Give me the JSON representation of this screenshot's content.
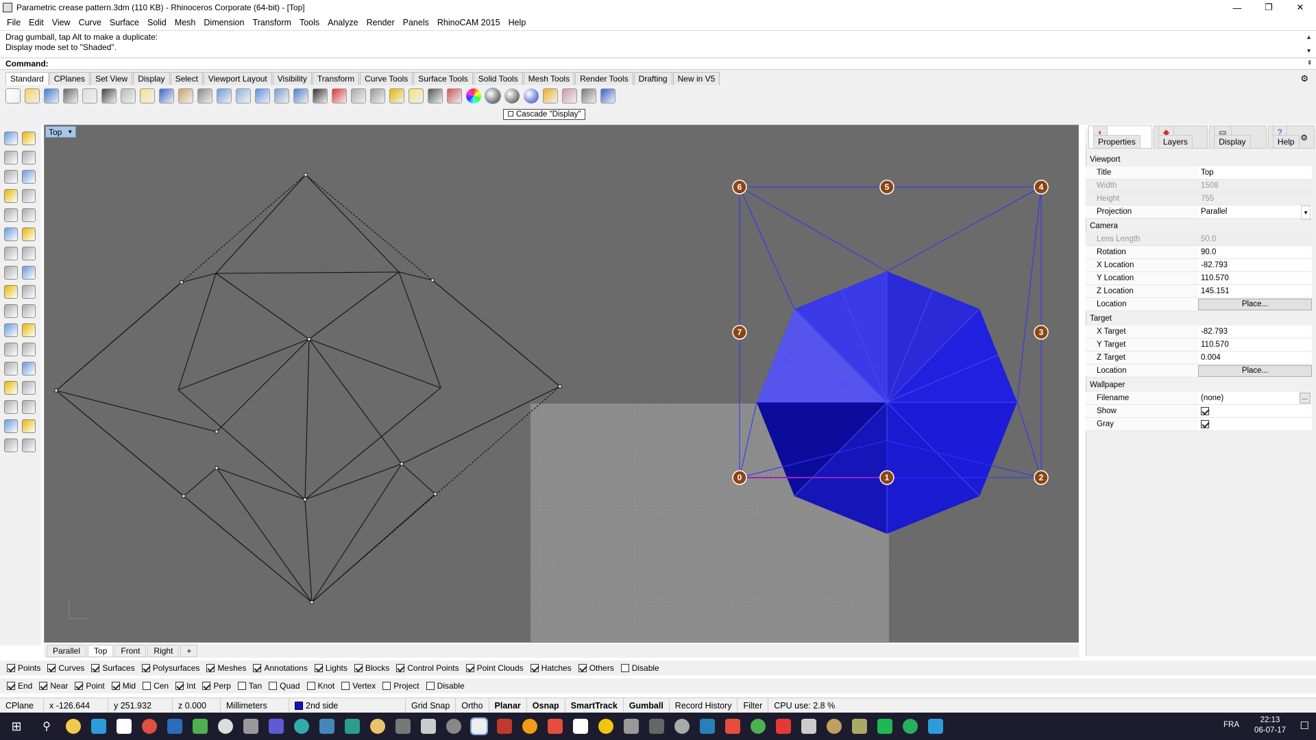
{
  "window": {
    "title": "Parametric crease pattern.3dm (110 KB) - Rhinoceros Corporate (64-bit) - [Top]",
    "minimize": "—",
    "maximize": "❐",
    "close": "✕"
  },
  "menu": [
    "File",
    "Edit",
    "View",
    "Curve",
    "Surface",
    "Solid",
    "Mesh",
    "Dimension",
    "Transform",
    "Tools",
    "Analyze",
    "Render",
    "Panels",
    "RhinoCAM 2015",
    "Help"
  ],
  "command_history": {
    "line1": "Drag gumball, tap Alt to make a duplicate:",
    "line2": "Display mode set to \"Shaded\"."
  },
  "command_prompt": "Command:",
  "toolbar_tabs": [
    "Standard",
    "CPlanes",
    "Set View",
    "Display",
    "Select",
    "Viewport Layout",
    "Visibility",
    "Transform",
    "Curve Tools",
    "Surface Tools",
    "Solid Tools",
    "Mesh Tools",
    "Render Tools",
    "Drafting",
    "New in V5"
  ],
  "toolbar_icons": [
    "new-file-icon",
    "open-file-icon",
    "save-icon",
    "print-icon",
    "import-icon",
    "cut-icon",
    "copy-icon",
    "paste-icon",
    "undo-icon",
    "pan-icon",
    "move-view-icon",
    "zoom-in-icon",
    "zoom-window-icon",
    "zoom-extents-icon",
    "zoom-selected-icon",
    "rotate-view-icon",
    "four-viewports-icon",
    "car-icon",
    "properties-icon",
    "circle-icon",
    "snap-icon",
    "light-icon",
    "lock-icon",
    "layer-icon",
    "color-wheel-icon",
    "shaded-sphere-icon",
    "rendered-sphere-icon",
    "blue-sphere-icon",
    "select-icon",
    "options-gear-icon",
    "snap-grid-icon",
    "help-icon"
  ],
  "tooltip": "Cascade \"Display\"",
  "viewport": {
    "name": "Top",
    "tabs": [
      "Parallel",
      "Top",
      "Front",
      "Right",
      "+"
    ],
    "active_tab": "Top",
    "point_labels": [
      "6",
      "5",
      "4",
      "7",
      "3",
      "0",
      "1",
      "2"
    ]
  },
  "panel": {
    "tabs": [
      "Properties",
      "Layers",
      "Display",
      "Help"
    ],
    "sections": {
      "viewport": "Viewport",
      "camera": "Camera",
      "target": "Target",
      "wallpaper": "Wallpaper"
    },
    "viewport_rows": [
      {
        "label": "Title",
        "value": "Top",
        "disabled": false
      },
      {
        "label": "Width",
        "value": "1508",
        "disabled": true
      },
      {
        "label": "Height",
        "value": "755",
        "disabled": true
      },
      {
        "label": "Projection",
        "value": "Parallel",
        "disabled": false
      }
    ],
    "camera_rows": [
      {
        "label": "Lens Length",
        "value": "50.0",
        "disabled": true
      },
      {
        "label": "Rotation",
        "value": "90.0",
        "disabled": false
      },
      {
        "label": "X Location",
        "value": "-82.793",
        "disabled": false
      },
      {
        "label": "Y Location",
        "value": "110.570",
        "disabled": false
      },
      {
        "label": "Z Location",
        "value": "145.151",
        "disabled": false
      }
    ],
    "camera_location": {
      "label": "Location",
      "button": "Place..."
    },
    "target_rows": [
      {
        "label": "X Target",
        "value": "-82.793"
      },
      {
        "label": "Y Target",
        "value": "110.570"
      },
      {
        "label": "Z Target",
        "value": "0.004"
      }
    ],
    "target_location": {
      "label": "Location",
      "button": "Place..."
    },
    "wallpaper_rows": {
      "filename_label": "Filename",
      "filename_value": "(none)",
      "filename_button": "...",
      "show_label": "Show",
      "gray_label": "Gray"
    }
  },
  "filters": [
    {
      "label": "Points",
      "checked": true
    },
    {
      "label": "Curves",
      "checked": true
    },
    {
      "label": "Surfaces",
      "checked": true
    },
    {
      "label": "Polysurfaces",
      "checked": true
    },
    {
      "label": "Meshes",
      "checked": true
    },
    {
      "label": "Annotations",
      "checked": true
    },
    {
      "label": "Lights",
      "checked": true
    },
    {
      "label": "Blocks",
      "checked": true
    },
    {
      "label": "Control Points",
      "checked": true
    },
    {
      "label": "Point Clouds",
      "checked": true
    },
    {
      "label": "Hatches",
      "checked": true
    },
    {
      "label": "Others",
      "checked": true
    },
    {
      "label": "Disable",
      "checked": false
    }
  ],
  "osnaps": [
    {
      "label": "End",
      "checked": true
    },
    {
      "label": "Near",
      "checked": true
    },
    {
      "label": "Point",
      "checked": true
    },
    {
      "label": "Mid",
      "checked": true
    },
    {
      "label": "Cen",
      "checked": false
    },
    {
      "label": "Int",
      "checked": true
    },
    {
      "label": "Perp",
      "checked": true
    },
    {
      "label": "Tan",
      "checked": false
    },
    {
      "label": "Quad",
      "checked": false
    },
    {
      "label": "Knot",
      "checked": false
    },
    {
      "label": "Vertex",
      "checked": false
    },
    {
      "label": "Project",
      "checked": false
    },
    {
      "label": "Disable",
      "checked": false
    }
  ],
  "status": {
    "cplane": "CPlane",
    "x": "x -126.644",
    "y": "y 251.932",
    "z": "z 0.000",
    "units": "Millimeters",
    "layer": "2nd side",
    "grid_snap": "Grid Snap",
    "ortho": "Ortho",
    "planar": "Planar",
    "osnap": "Osnap",
    "smarttrack": "SmartTrack",
    "gumball": "Gumball",
    "record_history": "Record History",
    "filter": "Filter",
    "cpu": "CPU use: 2.8 %"
  },
  "taskbar": {
    "language": "FRA",
    "time": "22:13",
    "date": "06-07-17"
  },
  "colors": {
    "viewport_bg": "#6b6b6b",
    "mesh_blue": "#1a1ae6",
    "point_badge": "#8b4513",
    "layer_swatch": "#1010d0"
  }
}
